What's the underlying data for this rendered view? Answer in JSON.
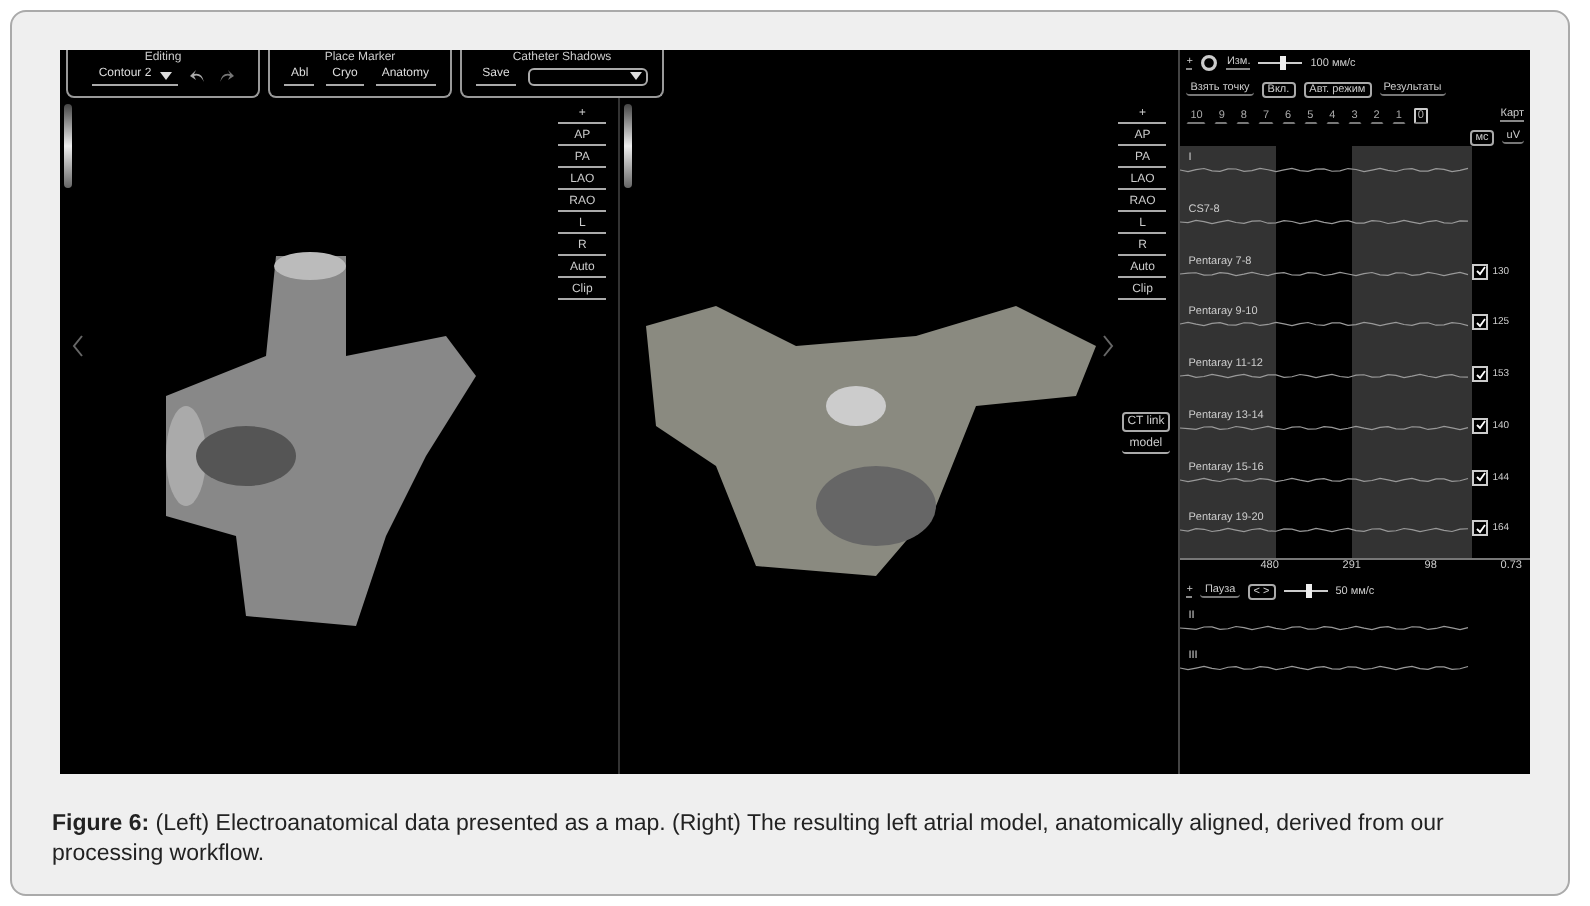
{
  "toolbar": [
    {
      "title": "Editing",
      "items": [
        {
          "kind": "dropdown",
          "label": "Contour 2"
        },
        {
          "kind": "undo"
        },
        {
          "kind": "redo"
        }
      ]
    },
    {
      "title": "Place Marker",
      "items": [
        {
          "kind": "button",
          "label": "Abl"
        },
        {
          "kind": "button",
          "label": "Cryo"
        },
        {
          "kind": "button",
          "label": "Anatomy"
        }
      ]
    },
    {
      "title": "Catheter Shadows",
      "items": [
        {
          "kind": "button",
          "label": "Save"
        },
        {
          "kind": "dropdown"
        }
      ]
    }
  ],
  "left_view": {
    "view_buttons": [
      "+",
      "AP",
      "PA",
      "LAO",
      "RAO",
      "L",
      "R",
      "Auto",
      "Clip"
    ]
  },
  "center_view": {
    "view_buttons": [
      "+",
      "AP",
      "PA",
      "LAO",
      "RAO",
      "L",
      "R",
      "Auto",
      "Clip"
    ],
    "side_buttons": [
      {
        "label": "CT link",
        "boxed": true
      },
      {
        "label": "model",
        "boxed": false
      }
    ]
  },
  "ecg": {
    "top": {
      "add": "+",
      "mode": "Изм.",
      "speed": {
        "level": 0.55
      },
      "speed_reading": "100 мм/с"
    },
    "actions": [
      {
        "label": "Взять точку",
        "boxed": false
      },
      {
        "label": "Вкл.",
        "boxed": true
      },
      {
        "label": "Авт. режим",
        "boxed": true
      },
      {
        "label": "Результаты",
        "boxed": false
      }
    ],
    "beats": [
      {
        "label": "10",
        "selected": false
      },
      {
        "label": "9",
        "selected": false
      },
      {
        "label": "8",
        "selected": false
      },
      {
        "label": "7",
        "selected": false
      },
      {
        "label": "6",
        "selected": false
      },
      {
        "label": "5",
        "selected": false
      },
      {
        "label": "4",
        "selected": false
      },
      {
        "label": "3",
        "selected": false
      },
      {
        "label": "2",
        "selected": false
      },
      {
        "label": "1",
        "selected": false
      },
      {
        "label": "0",
        "selected": true
      }
    ],
    "tab_label": "Карт",
    "units": [
      {
        "label": "мс",
        "boxed": true
      },
      {
        "label": "uV",
        "boxed": false
      }
    ],
    "channels": [
      {
        "kind": "plain",
        "name": "I"
      },
      {
        "kind": "plain",
        "name": "CS7-8"
      },
      {
        "kind": "checked",
        "name": "Pentaray 7-8",
        "checked": true,
        "value": "130"
      },
      {
        "kind": "checked",
        "name": "Pentaray 9-10",
        "checked": true,
        "value": "125"
      },
      {
        "kind": "checked",
        "name": "Pentaray 11-12",
        "checked": true,
        "value": "153"
      },
      {
        "kind": "checked",
        "name": "Pentaray 13-14",
        "checked": true,
        "value": "140"
      },
      {
        "kind": "checked",
        "name": "Pentaray 15-16",
        "checked": true,
        "value": "144"
      },
      {
        "kind": "checked",
        "name": "Pentaray 19-20",
        "checked": true,
        "value": "164"
      }
    ],
    "axis_labels": [
      "480",
      "291",
      "98",
      "0.73"
    ],
    "lower": {
      "add": "+",
      "pause": "Пауза",
      "nav": "< >",
      "speed": {
        "level": 0.6
      },
      "speed_reading": "50 мм/с",
      "channels": [
        "II",
        "III"
      ]
    }
  },
  "caption": "**Figure 6:** (Left) Electroanatomical data presented as a map. (Right) The resulting left atrial model, anatomically aligned, derived from our processing workflow."
}
